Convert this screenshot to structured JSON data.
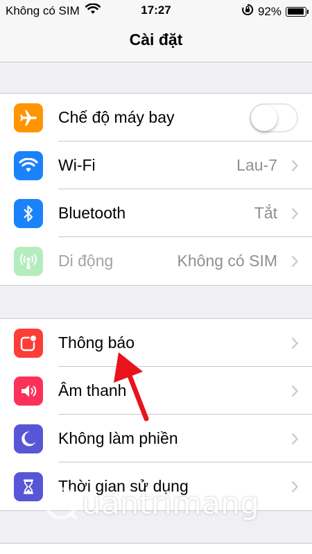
{
  "status_bar": {
    "carrier": "Không có SIM",
    "time": "17:27",
    "battery_percent": "92%",
    "battery_level": 0.92
  },
  "nav": {
    "title": "Cài đặt"
  },
  "groups": [
    [
      {
        "label": "Chế độ máy bay",
        "icon": "airplane-icon",
        "color": "#ff9500",
        "toggle": false
      },
      {
        "label": "Wi-Fi",
        "icon": "wifi-icon",
        "color": "#1a82fb",
        "value": "Lau-7"
      },
      {
        "label": "Bluetooth",
        "icon": "bluetooth-icon",
        "color": "#1a82fb",
        "value": "Tắt"
      },
      {
        "label": "Di động",
        "icon": "cellular-icon",
        "color": "#b4ecbe",
        "value": "Không có SIM",
        "disabled": true
      }
    ],
    [
      {
        "label": "Thông báo",
        "icon": "notifications-icon",
        "color": "#fc3d39"
      },
      {
        "label": "Âm thanh",
        "icon": "sounds-icon",
        "color": "#fc3159"
      },
      {
        "label": "Không làm phiền",
        "icon": "moon-icon",
        "color": "#5856d6"
      },
      {
        "label": "Thời gian sử dụng",
        "icon": "hourglass-icon",
        "color": "#5856d6"
      }
    ]
  ],
  "watermark": {
    "text": "uantrimang"
  }
}
